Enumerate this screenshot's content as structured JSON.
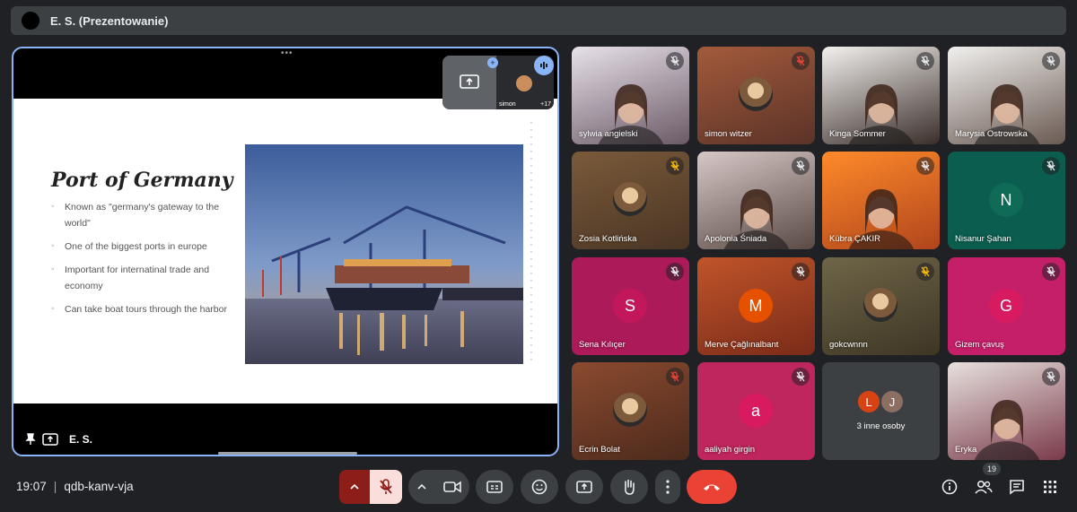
{
  "presenter_bar": {
    "title": "E. S. (Prezentowanie)"
  },
  "presentation": {
    "pip_name": "simon",
    "pip_count": "+17",
    "footer_name": "E. S.",
    "slide": {
      "title": "Port of Germany",
      "bullets": [
        "Known as \"germany's gateway to the world\"",
        "One of the biggest ports in europe",
        "Important for internatinal trade and economy",
        "Can take boat tours through the harbor"
      ]
    }
  },
  "tiles": [
    {
      "name": "sylwia angielski",
      "kind": "video",
      "mute": "muted"
    },
    {
      "name": "simon witzer",
      "kind": "avatar-photo",
      "mute": "muted-red"
    },
    {
      "name": "Kinga Sommer",
      "kind": "video",
      "mute": "muted"
    },
    {
      "name": "Marysia Ostrowska",
      "kind": "video",
      "mute": "muted"
    },
    {
      "name": "Zosia Kotlińska",
      "kind": "avatar-photo",
      "mute": "muted-amber"
    },
    {
      "name": "Apolonia Śniada",
      "kind": "video",
      "mute": "muted"
    },
    {
      "name": "Kübra ÇAKIR",
      "kind": "video",
      "mute": "muted"
    },
    {
      "name": "Nisanur Şahan",
      "kind": "initial",
      "initial": "N",
      "mute": "muted"
    },
    {
      "name": "Sena Kılıçer",
      "kind": "initial",
      "initial": "S",
      "mute": "muted"
    },
    {
      "name": "Merve Çağlınalbant",
      "kind": "initial",
      "initial": "M",
      "mute": "muted"
    },
    {
      "name": "gokcwnnn",
      "kind": "avatar-photo",
      "mute": "muted-amber"
    },
    {
      "name": "Gizem çavuş",
      "kind": "initial",
      "initial": "G",
      "mute": "muted"
    },
    {
      "name": "Ecrin Bolat",
      "kind": "avatar-photo",
      "mute": "muted-red"
    },
    {
      "name": "aaliyah girgin",
      "kind": "initial",
      "initial": "a",
      "mute": "muted"
    },
    {
      "name": "3 inne osoby",
      "kind": "others",
      "initials": [
        "L",
        "J"
      ]
    },
    {
      "name": "Eryka",
      "kind": "video",
      "mute": "muted"
    }
  ],
  "controls": {
    "time": "19:07",
    "meeting_code": "qdb-kanv-vja",
    "participants_badge": "19"
  },
  "colors": {
    "accent": "#8ab4f8",
    "end_call": "#ea4335",
    "mic_off_bg": "#f9dedc",
    "mute_red": "#ea4335",
    "mute_amber": "#fbbc04"
  }
}
